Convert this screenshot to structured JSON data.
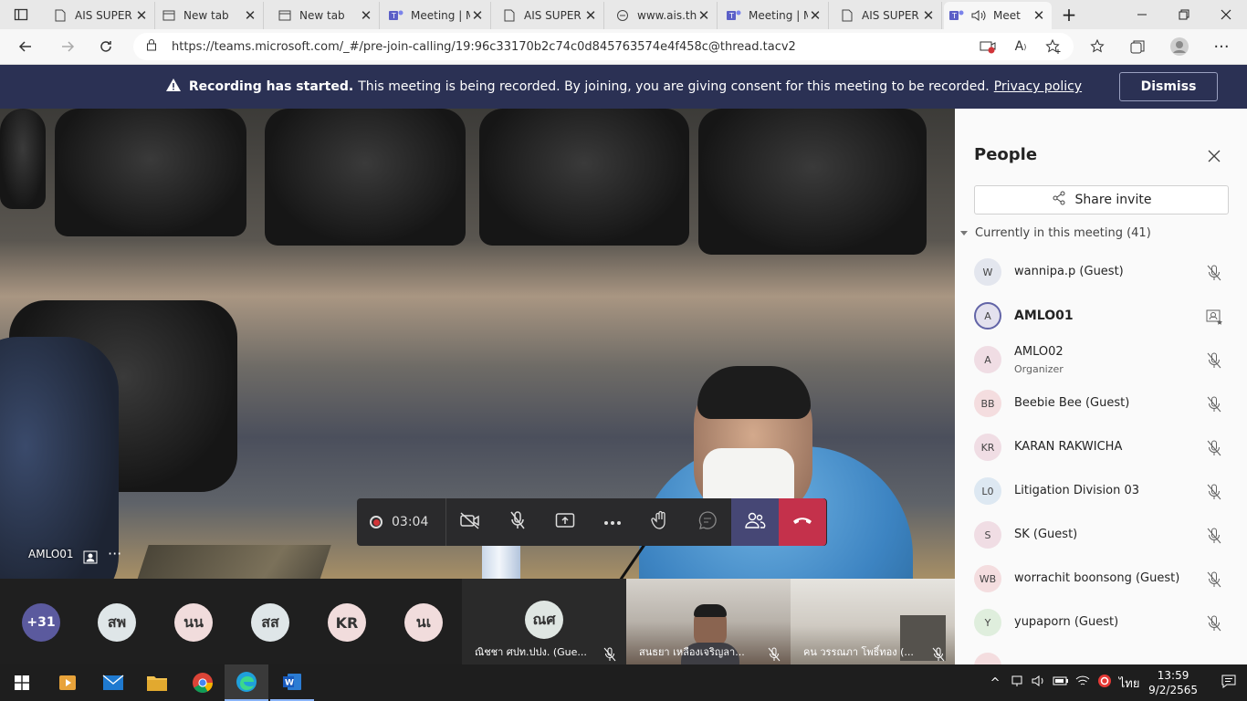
{
  "browser": {
    "tabs": [
      {
        "title": "AIS SUPER",
        "icon": "page-icon"
      },
      {
        "title": "New tab",
        "icon": "page-icon"
      },
      {
        "title": "New tab",
        "icon": "page-icon"
      },
      {
        "title": "Meeting | M",
        "icon": "teams-icon"
      },
      {
        "title": "AIS SUPER",
        "icon": "page-icon"
      },
      {
        "title": "www.ais.th",
        "icon": "link-icon"
      },
      {
        "title": "Meeting | M",
        "icon": "teams-icon"
      },
      {
        "title": "AIS SUPER",
        "icon": "page-icon"
      },
      {
        "title": "Meet",
        "icon": "teams-icon",
        "active": true
      }
    ],
    "url": "https://teams.microsoft.com/_#/pre-join-calling/19:96c33170b2c74c0d845763574e4f458c@thread.tacv2"
  },
  "banner": {
    "bold_text": "Recording has started.",
    "text": "This meeting is being recorded. By joining, you are giving consent for this meeting to be recorded.",
    "link": "Privacy policy",
    "dismiss": "Dismiss"
  },
  "stage": {
    "speaker_name": "AMLO01",
    "more": "···"
  },
  "controls": {
    "timer": "03:04"
  },
  "strip": {
    "overflow": "+31",
    "avatars": [
      "สพ",
      "นน",
      "สส",
      "KR",
      "นเ"
    ],
    "tiles": [
      {
        "initials": "ณศ",
        "name": "ณิชชา ศปท.ปปง. (Gue..."
      },
      {
        "name": "สนธยา เหลืองเจริญลา..."
      },
      {
        "name": "คน วรรณภา โพธิ์ทอง (..."
      }
    ]
  },
  "panel": {
    "title": "People",
    "share_label": "Share invite",
    "current_label": "Currently in this meeting (41)",
    "participants": [
      {
        "initials": "W",
        "name": "wannipa.p (Guest)",
        "color": "#e3e6ee"
      },
      {
        "initials": "A",
        "name": "AMLO01",
        "color": "#e3e1ee"
      },
      {
        "initials": "A",
        "name": "AMLO02",
        "role": "Organizer",
        "color": "#f0dde4"
      },
      {
        "initials": "BB",
        "name": "Beebie Bee (Guest)",
        "color": "#f4dddf"
      },
      {
        "initials": "KR",
        "name": "KARAN RAKWICHA",
        "color": "#f0dde4"
      },
      {
        "initials": "L0",
        "name": "Litigation Division 03",
        "color": "#dde8f2"
      },
      {
        "initials": "S",
        "name": "SK (Guest)",
        "color": "#f0dde4"
      },
      {
        "initials": "WB",
        "name": "worrachit boonsong (Guest)",
        "color": "#f4dddf"
      },
      {
        "initials": "Y",
        "name": "yupaporn (Guest)",
        "color": "#dfeedd"
      }
    ]
  },
  "taskbar": {
    "lang": "ไทย",
    "time": "13:59",
    "date": "9/2/2565"
  },
  "colors": {
    "banner": "#2b3154",
    "teams_purple": "#464775",
    "leave_red": "#c4314b"
  }
}
